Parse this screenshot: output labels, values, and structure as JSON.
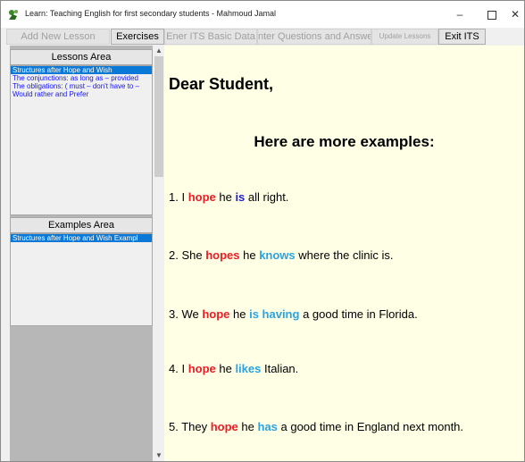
{
  "window": {
    "title": "Learn: Teaching English for first secondary students  - Mahmoud Jamal",
    "minimize_glyph": "–",
    "close_glyph": "✕"
  },
  "toolbar": {
    "add_new_lesson": "Add New Lesson",
    "exercises": "Exercises",
    "enter_its_basic_data": "Ener ITS Basic Data",
    "enter_questions": "nter Questions and Answer",
    "update_lessons": "Update Lessons",
    "exit_its": "Exit ITS"
  },
  "lessons": {
    "header": "Lessons Area",
    "items": [
      "Structures after Hope and Wish",
      "The conjunctions: as long as – provided",
      "The obligations: ( must – don't have to –",
      "Would rather and Prefer"
    ]
  },
  "examples_area": {
    "header": "Examples Area",
    "items": [
      "Structures after Hope and Wish Exampl"
    ]
  },
  "content": {
    "greeting": "Dear Student,",
    "heading": "Here are more examples:",
    "examples": [
      {
        "num": "1. I ",
        "hope": "hope",
        "mid": " he ",
        "verb": "is",
        "rest": " all right."
      },
      {
        "num": "2. She ",
        "hope": "hopes",
        "mid": " he ",
        "verb": "knows",
        "rest": " where the clinic is."
      },
      {
        "num": "3. We ",
        "hope": "hope",
        "mid": " he ",
        "verb": "is having",
        "rest": " a good time in Florida."
      },
      {
        "num": "4. I ",
        "hope": "hope",
        "mid": " he ",
        "verb": "likes",
        "rest": " Italian."
      },
      {
        "num": "5. They ",
        "hope": "hope",
        "mid": " he ",
        "verb": "has",
        "rest": " a good time in England next month."
      }
    ]
  },
  "colors": {
    "keyword_hope": "#ec1c24",
    "keyword_verb": "#29a3e1",
    "list_text": "#1414ff",
    "selection": "#0a78d6",
    "content_bg": "#ffffe6"
  }
}
